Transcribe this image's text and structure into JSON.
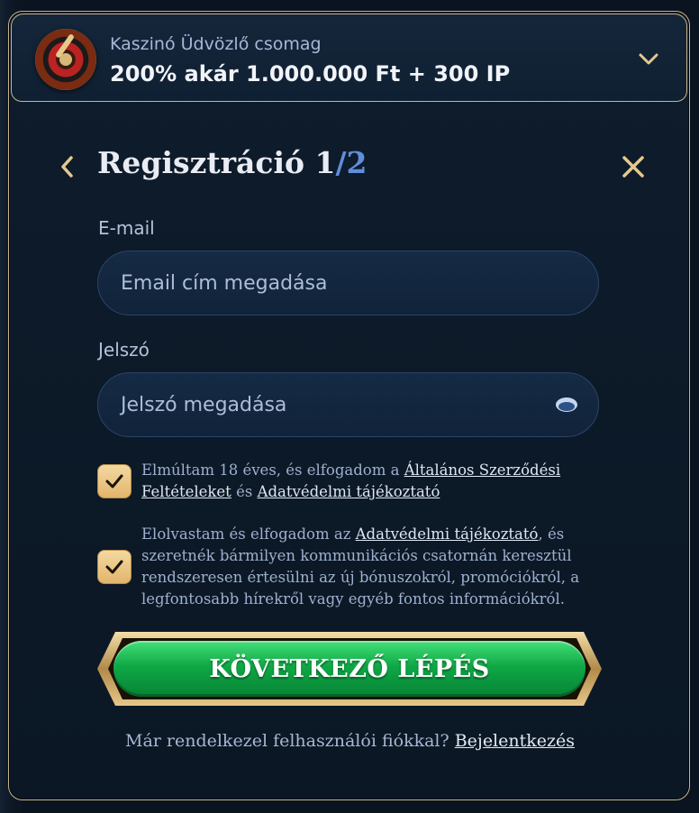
{
  "promo": {
    "label": "Kaszinó Üdvözlő csomag",
    "value": "200% akár 1.000.000 Ft + 300 IP",
    "icon": "roulette-icon",
    "expand_icon": "chevron-down-icon"
  },
  "header": {
    "title": "Regisztráció 1",
    "step_separator": "/",
    "step_total": "2",
    "back_icon": "chevron-left-icon",
    "close_icon": "close-icon"
  },
  "form": {
    "email": {
      "label": "E-mail",
      "placeholder": "Email cím megadása"
    },
    "password": {
      "label": "Jelszó",
      "placeholder": "Jelszó megadása",
      "toggle_icon": "eye-icon"
    }
  },
  "consents": [
    {
      "checked": true,
      "text_before": "Elmúltam 18 éves, és elfogadom a ",
      "link1": "Általános Szerződési Feltételeket",
      "text_middle": " és ",
      "link2": "Adatvédelmi tájékoztató"
    },
    {
      "checked": true,
      "text_before": "Elolvastam és elfogadom az ",
      "link1": "Adatvédelmi tájékoztató",
      "text_after": ", és szeretnék bármilyen kommunikációs csatornán keresztül rendszeresen értesülni az új bónuszokról, promóciókról, a legfontosabb hírekről vagy egyéb fontos információkról."
    }
  ],
  "cta": {
    "label": "KÖVETKEZŐ LÉPÉS"
  },
  "footer": {
    "text": "Már rendelkezel felhasználói fiókkal? ",
    "link": "Bejelentkezés"
  },
  "colors": {
    "accent_gold": "#c9b48a",
    "cta_green": "#0fa845",
    "step_blue": "#5f8fdb",
    "background": "#0b1724"
  }
}
